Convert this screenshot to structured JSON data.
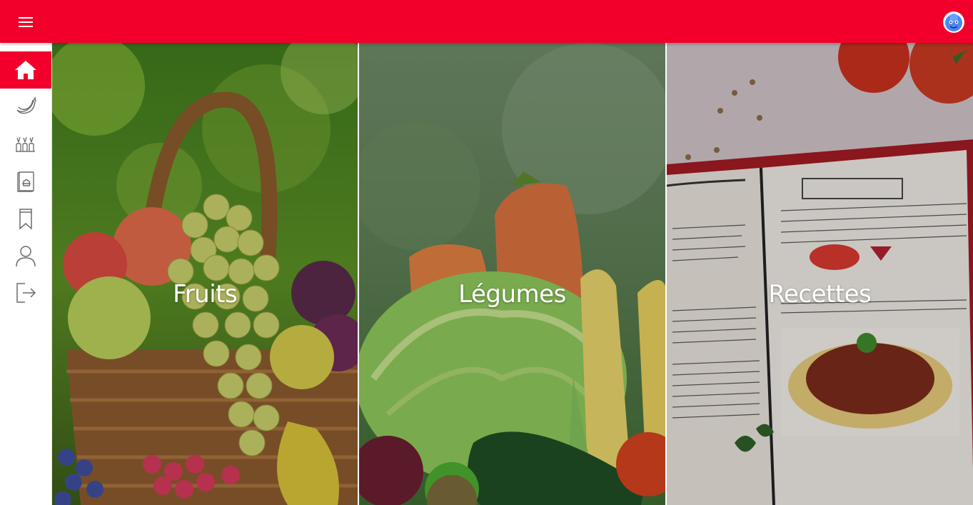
{
  "colors": {
    "brand": "#f2002b",
    "sidebar_active": "#f2002b",
    "icon_inactive": "#6b6b6b"
  },
  "header": {
    "menu_icon": "hamburger-menu-icon",
    "avatar_icon": "user-avatar-icon"
  },
  "sidebar": {
    "items": [
      {
        "icon": "home-icon",
        "active": true
      },
      {
        "icon": "banana-icon",
        "active": false
      },
      {
        "icon": "vegetables-icon",
        "active": false
      },
      {
        "icon": "recipe-book-icon",
        "active": false
      },
      {
        "icon": "bookmark-icon",
        "active": false
      },
      {
        "icon": "user-icon",
        "active": false
      },
      {
        "icon": "logout-icon",
        "active": false
      }
    ]
  },
  "categories": [
    {
      "label": "Fruits"
    },
    {
      "label": "Légumes"
    },
    {
      "label": "Recettes"
    }
  ]
}
